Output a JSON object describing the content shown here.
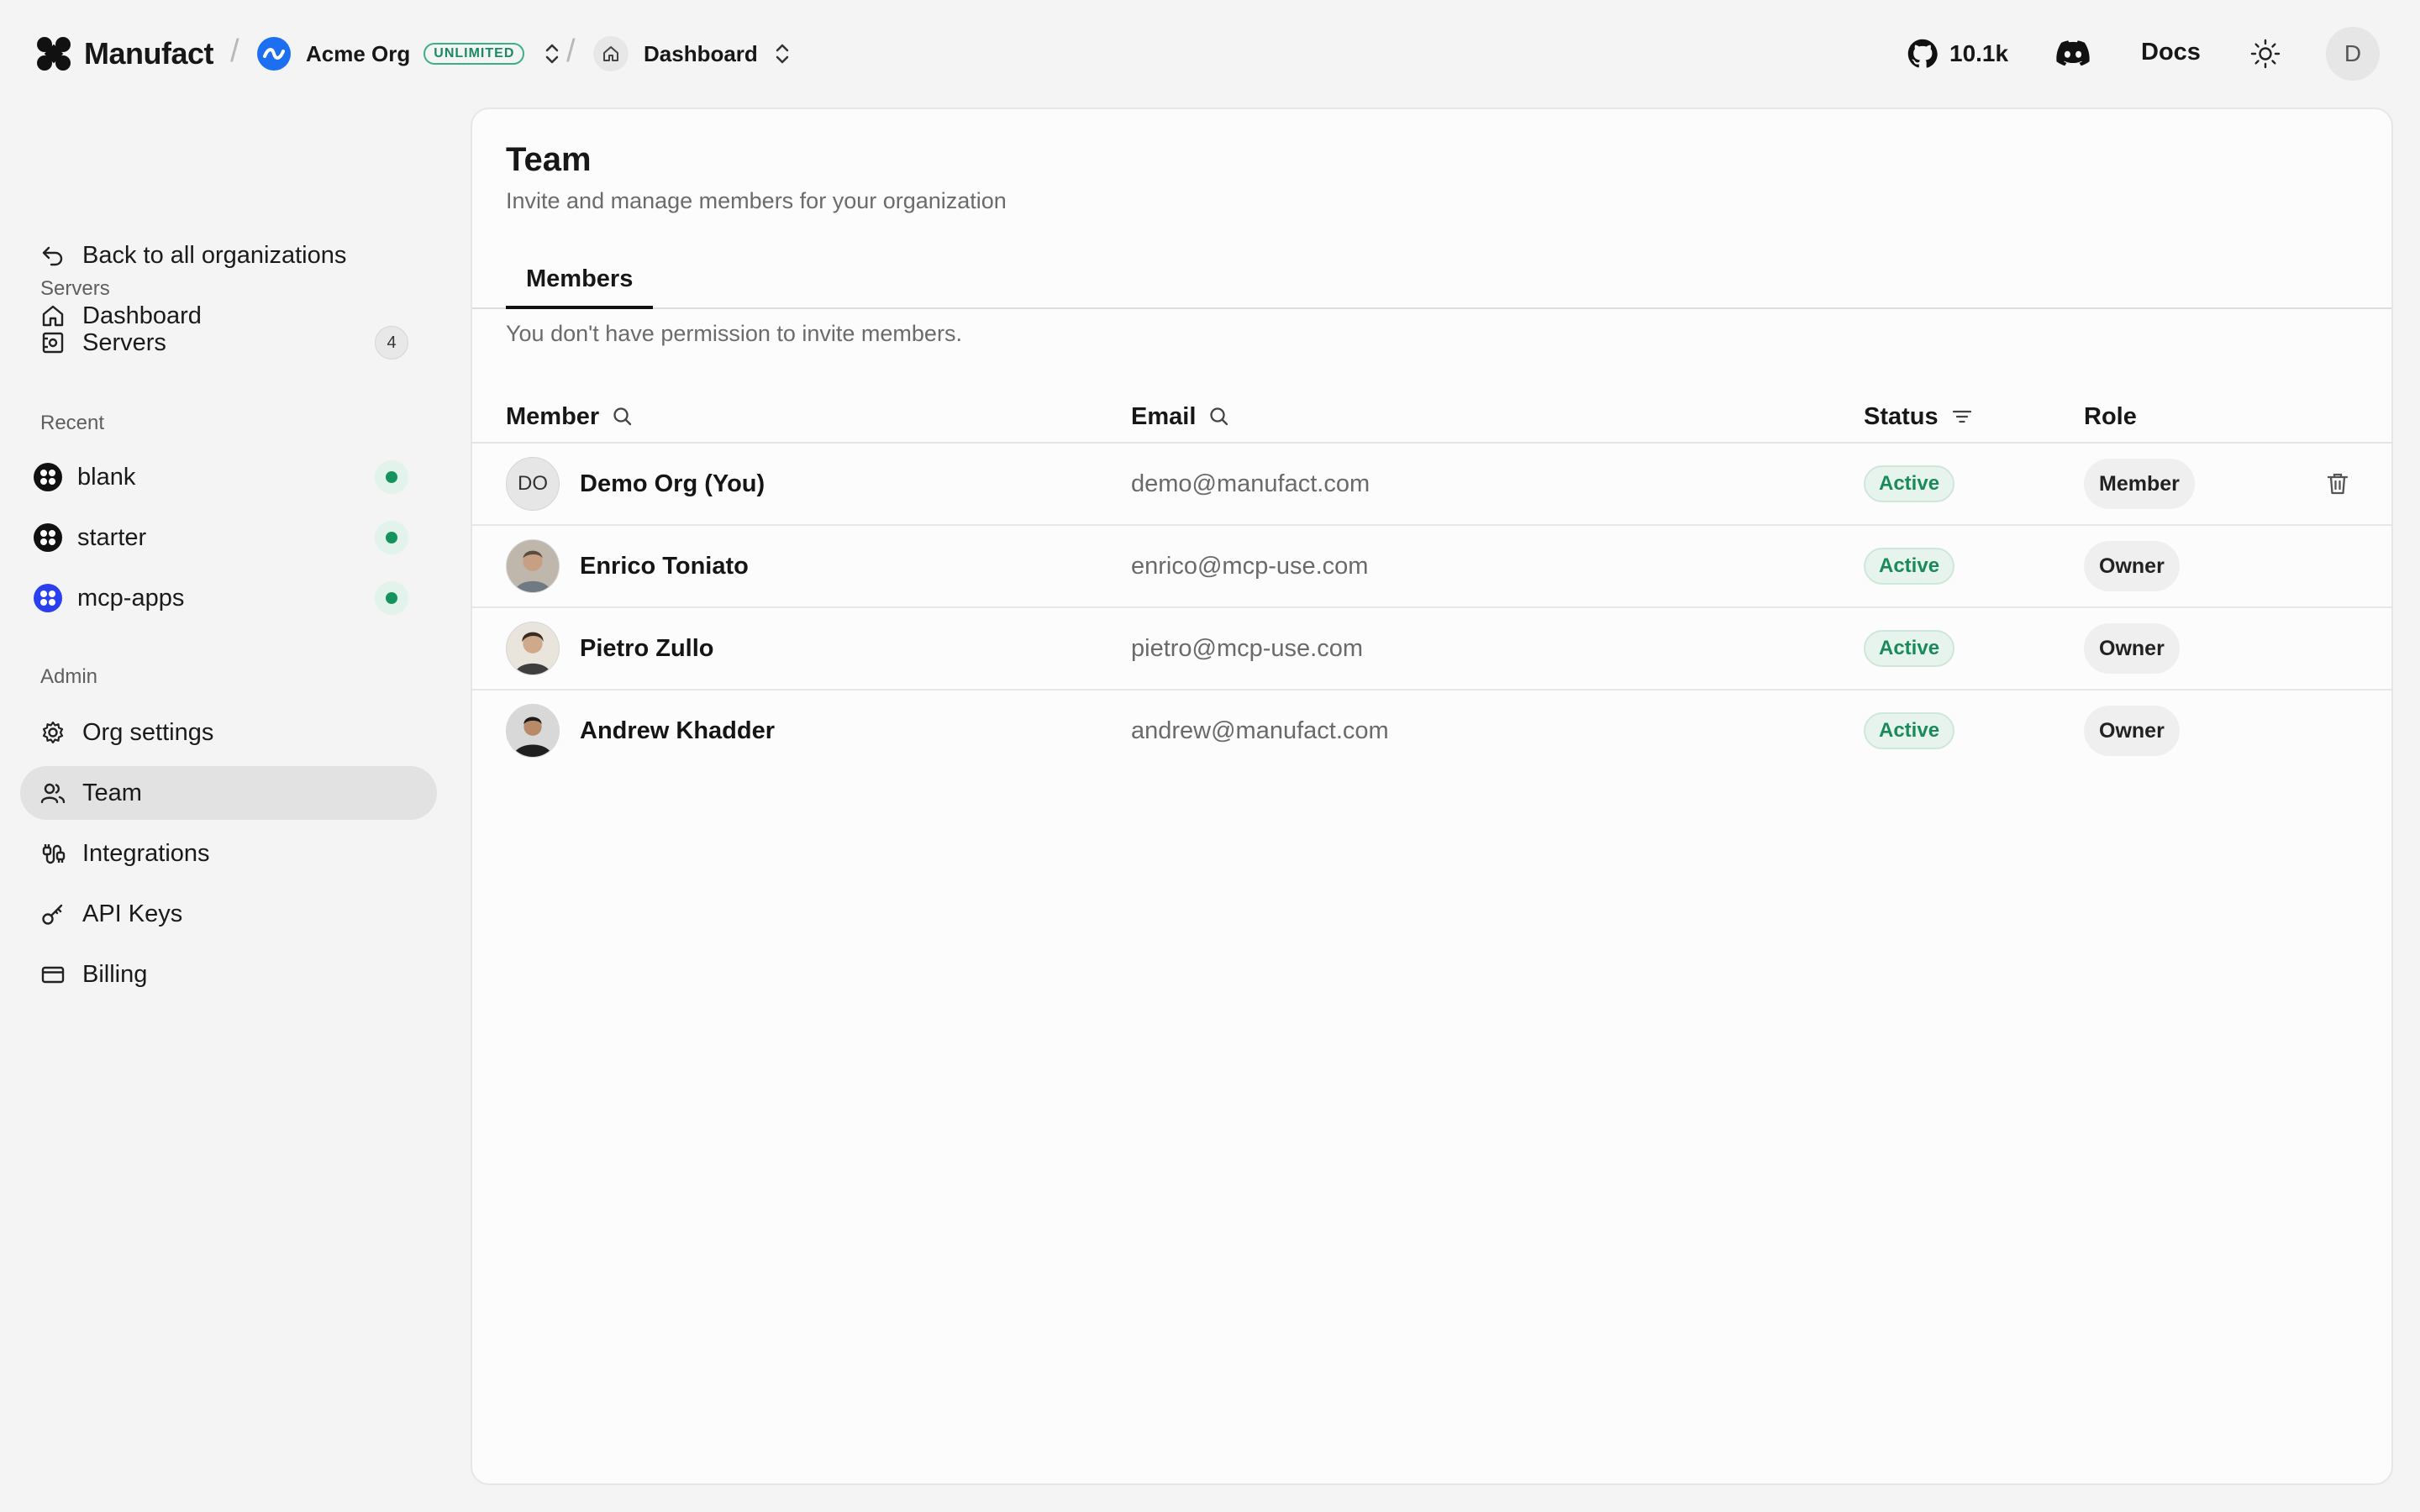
{
  "topbar": {
    "brand": "Manufact",
    "org_name": "Acme Org",
    "org_plan": "UNLIMITED",
    "project": "Dashboard",
    "github_stars": "10.1k",
    "docs_label": "Docs",
    "user_initial": "D"
  },
  "sidebar": {
    "back_label": "Back to all organizations",
    "dashboard_label": "Dashboard",
    "servers_section": "Servers",
    "servers_label": "Servers",
    "servers_count": "4",
    "recent_section": "Recent",
    "recent": [
      {
        "name": "blank",
        "status": "online"
      },
      {
        "name": "starter",
        "status": "online"
      },
      {
        "name": "mcp-apps",
        "status": "online"
      }
    ],
    "admin_section": "Admin",
    "admin": [
      {
        "label": "Org settings",
        "icon": "gear-icon"
      },
      {
        "label": "Team",
        "icon": "users-icon",
        "active": true
      },
      {
        "label": "Integrations",
        "icon": "plug-icon"
      },
      {
        "label": "API Keys",
        "icon": "key-icon"
      },
      {
        "label": "Billing",
        "icon": "credit-card-icon"
      }
    ]
  },
  "main": {
    "title": "Team",
    "subtitle": "Invite and manage members for your organization",
    "tabs": [
      {
        "label": "Members",
        "active": true
      }
    ],
    "notice": "You don't have permission to invite members.",
    "columns": {
      "member": "Member",
      "email": "Email",
      "status": "Status",
      "role": "Role"
    },
    "members": [
      {
        "initials": "DO",
        "name": "Demo Org (You)",
        "email": "demo@manufact.com",
        "status": "Active",
        "role": "Member",
        "avatar": "initials"
      },
      {
        "initials": "",
        "name": "Enrico Toniato",
        "email": "enrico@mcp-use.com",
        "status": "Active",
        "role": "Owner",
        "avatar": "photo"
      },
      {
        "initials": "",
        "name": "Pietro Zullo",
        "email": "pietro@mcp-use.com",
        "status": "Active",
        "role": "Owner",
        "avatar": "photo"
      },
      {
        "initials": "",
        "name": "Andrew Khadder",
        "email": "andrew@manufact.com",
        "status": "Active",
        "role": "Owner",
        "avatar": "photo"
      }
    ]
  },
  "colors": {
    "accent_green": "#1a8a5a",
    "org_blue": "#1d6ff2",
    "mcp_apps_blue": "#2a3ff0"
  }
}
